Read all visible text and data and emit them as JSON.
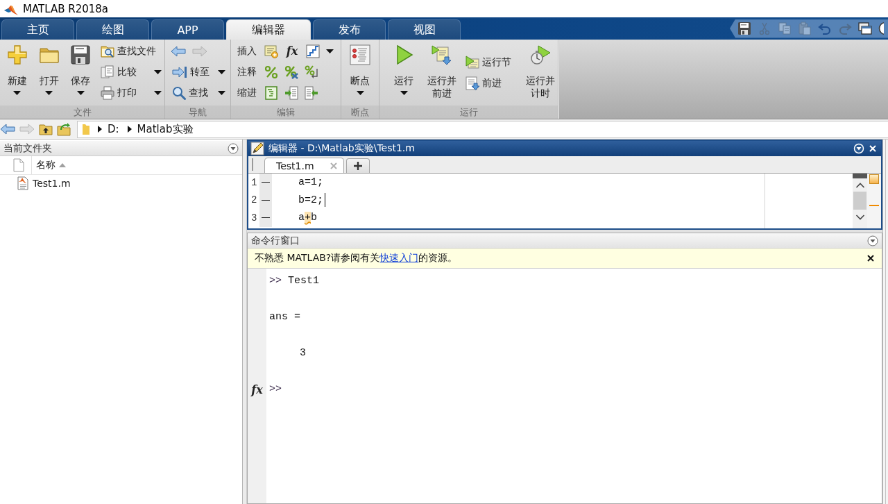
{
  "window": {
    "title": "MATLAB R2018a"
  },
  "tabs": [
    {
      "label": "主页",
      "selected": false
    },
    {
      "label": "绘图",
      "selected": false
    },
    {
      "label": "APP",
      "selected": false
    },
    {
      "label": "编辑器",
      "selected": true
    },
    {
      "label": "发布",
      "selected": false
    },
    {
      "label": "视图",
      "selected": false
    }
  ],
  "quick_access": [
    {
      "kind": "save",
      "disabled": false
    },
    {
      "kind": "cut",
      "disabled": true
    },
    {
      "kind": "copy",
      "disabled": true
    },
    {
      "kind": "paste",
      "disabled": true
    },
    {
      "kind": "undo",
      "disabled": false
    },
    {
      "kind": "redo",
      "disabled": true
    },
    {
      "kind": "window",
      "disabled": false
    },
    {
      "kind": "help",
      "disabled": false
    }
  ],
  "ribbon": [
    {
      "label": "文件",
      "controls": [
        {
          "kind": "large",
          "label": "新建",
          "dropdown": true
        },
        {
          "kind": "large",
          "label": "打开",
          "dropdown": true
        },
        {
          "kind": "large",
          "label": "保存",
          "dropdown": true
        },
        {
          "kind": "stack",
          "items": [
            {
              "kind": "button",
              "label": "查找文件",
              "dropdown": false
            },
            {
              "kind": "button",
              "label": "比较",
              "dropdown": true
            },
            {
              "kind": "button",
              "label": "打印",
              "dropdown": true
            }
          ]
        }
      ]
    },
    {
      "label": "导航",
      "controls": [
        {
          "kind": "stack",
          "items": [
            {
              "kind": "icons",
              "buttons": [
                {
                  "disabled": false
                },
                {
                  "disabled": true
                }
              ],
              "dropdown": false
            },
            {
              "kind": "button",
              "label": "转至",
              "dropdown": true
            },
            {
              "kind": "button",
              "label": "查找",
              "dropdown": true
            }
          ]
        }
      ]
    },
    {
      "label": "编辑",
      "controls": [
        {
          "kind": "stack",
          "items": [
            {
              "kind": "icons",
              "label": "插入",
              "buttons": [
                {
                  "disabled": false
                },
                {
                  "text": "fx",
                  "disabled": false
                },
                {
                  "disabled": false
                }
              ],
              "dropdown": true
            },
            {
              "kind": "icons",
              "label": "注释",
              "buttons": [
                {
                  "disabled": false
                },
                {
                  "disabled": false
                },
                {
                  "disabled": false
                }
              ],
              "dropdown": false
            },
            {
              "kind": "icons",
              "label": "缩进",
              "buttons": [
                {
                  "disabled": false
                },
                {
                  "disabled": false
                },
                {
                  "disabled": false
                }
              ],
              "dropdown": false
            }
          ]
        }
      ]
    },
    {
      "label": "断点",
      "controls": [
        {
          "kind": "large",
          "label": "断点",
          "dropdown": true
        }
      ]
    },
    {
      "label": "运行",
      "controls": [
        {
          "kind": "large",
          "label": "运行",
          "dropdown": true
        },
        {
          "kind": "large",
          "label": "运行并前进",
          "dropdown": false
        },
        {
          "kind": "stack",
          "items": [
            {
              "kind": "button",
              "label": "运行节",
              "dropdown": false
            },
            {
              "kind": "button",
              "label": "前进",
              "dropdown": false
            }
          ]
        },
        {
          "kind": "large",
          "label": "运行并计时",
          "dropdown": false
        }
      ]
    }
  ],
  "address_bar": {
    "buttons": [
      {
        "kind": "back",
        "disabled": false
      },
      {
        "kind": "forward",
        "disabled": true
      },
      {
        "kind": "up",
        "disabled": false
      },
      {
        "kind": "browse",
        "disabled": false
      }
    ],
    "path": [
      "D:",
      "Matlab实验"
    ]
  },
  "current_folder": {
    "title": "当前文件夹",
    "columns": [
      {
        "label": "名称",
        "sorted": true
      }
    ],
    "files": [
      {
        "name": "Test1.m",
        "selected": false
      }
    ]
  },
  "editor": {
    "title": "编辑器 - D:\\Matlab实验\\Test1.m",
    "tabs": [
      {
        "label": "Test1.m",
        "selected": true
      }
    ],
    "lines": [
      {
        "number": "1",
        "segments": [
          {
            "text": "a=1;",
            "warning": false
          }
        ],
        "cursor": false
      },
      {
        "number": "2",
        "segments": [
          {
            "text": "b=2;",
            "warning": false
          }
        ],
        "cursor": true
      },
      {
        "number": "3",
        "segments": [
          {
            "text": "a",
            "warning": false
          },
          {
            "text": "+",
            "warning": true
          },
          {
            "text": "b",
            "warning": false
          }
        ],
        "cursor": false
      }
    ]
  },
  "command_window": {
    "title": "命令行窗口",
    "notice": {
      "text": "不熟悉 MATLAB?请参阅有关",
      "link": "快速入门",
      "text_after": "的资源。"
    },
    "function_browser": "fx",
    "output": [
      {
        "kind": "command",
        "prompt": ">>",
        "text": "Test1"
      },
      {
        "kind": "text",
        "text": "ans ="
      },
      {
        "kind": "value",
        "text": "3"
      },
      {
        "kind": "prompt",
        "prompt": ">>"
      }
    ]
  }
}
